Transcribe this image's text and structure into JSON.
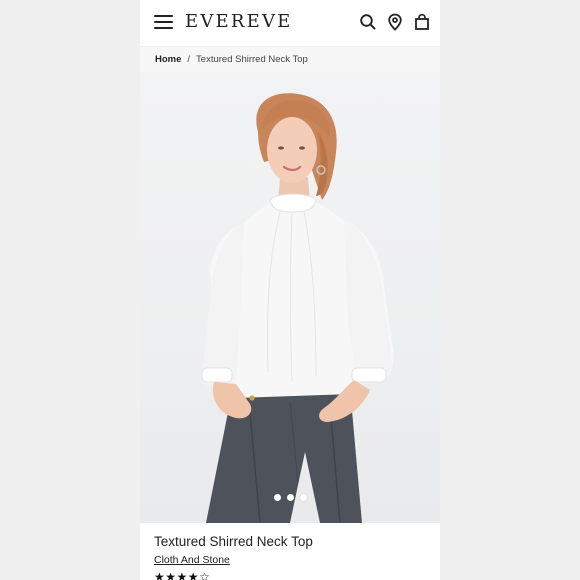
{
  "header": {
    "logo": "EVEREVE",
    "menu_icon": "hamburger-menu-icon",
    "search_icon": "search-icon",
    "location_icon": "location-pin-icon",
    "bag_icon": "shopping-bag-icon"
  },
  "breadcrumb": {
    "home": "Home",
    "separator": "/",
    "current": "Textured Shirred Neck Top"
  },
  "product": {
    "image_alt_icon": "product-photo",
    "gallery_dots": 3,
    "active_dot": 1,
    "name": "Textured Shirred Neck Top",
    "brand": "Cloth And Stone",
    "rating": 4,
    "rating_max": 5
  },
  "colors": {
    "page_background": "#f0f0f0",
    "text": "#222222",
    "blouse": "#f7f7f7",
    "pants": "#4e535b"
  }
}
